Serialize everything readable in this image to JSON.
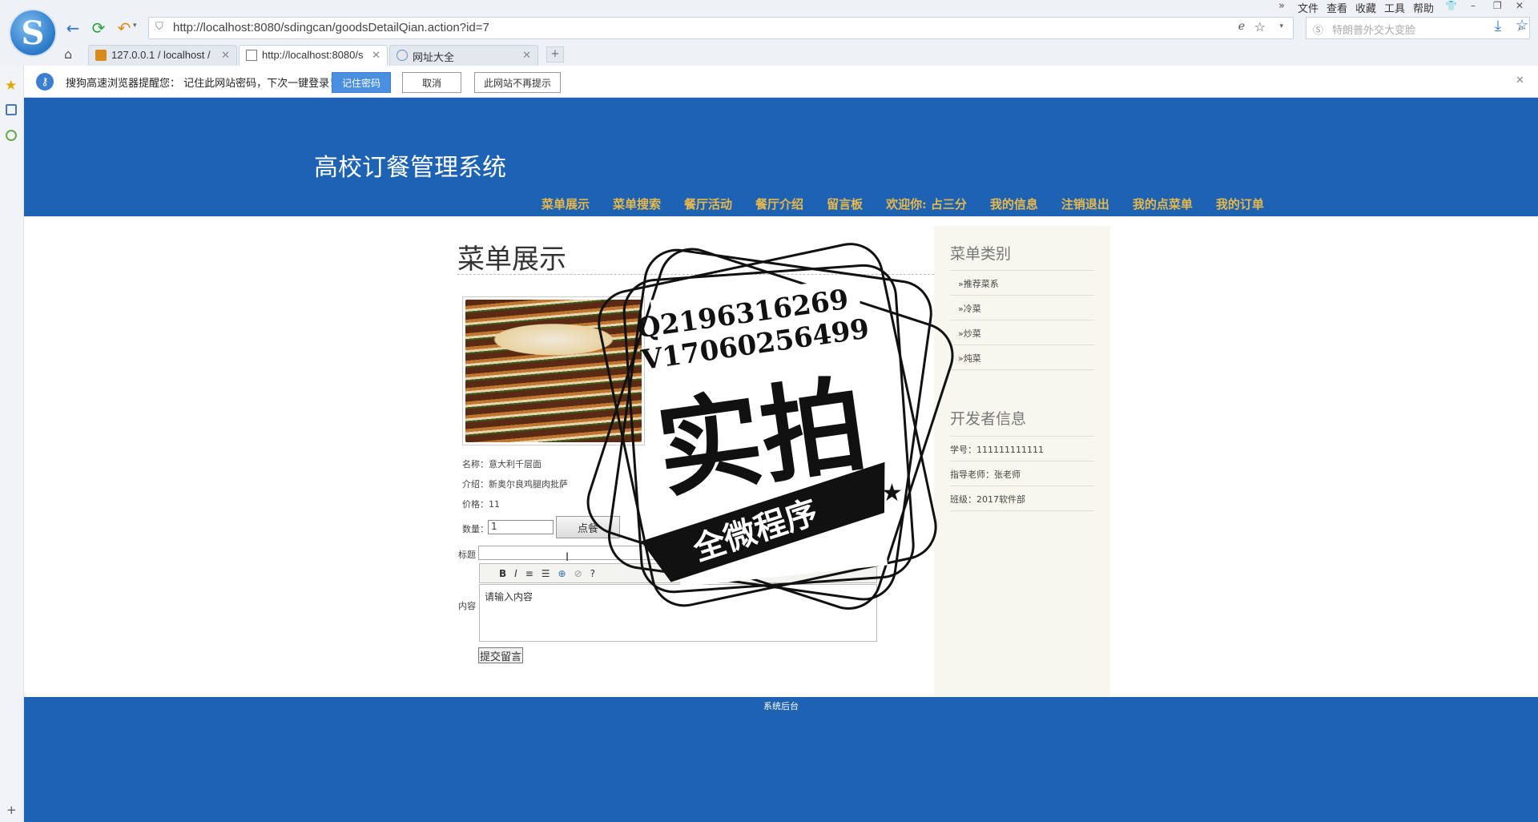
{
  "browser": {
    "url": "http://localhost:8080/sdingcan/goodsDetailQian.action?id=7",
    "search_placeholder": "特朗普外交大变脸",
    "menu": [
      "文件",
      "查看",
      "收藏",
      "工具",
      "帮助"
    ],
    "tabs": [
      {
        "label": "127.0.0.1 / localhost /",
        "active": false
      },
      {
        "label": "http://localhost:8080/s",
        "active": true
      },
      {
        "label": "网址大全",
        "active": false
      }
    ],
    "accent": "#2a78c8"
  },
  "password_bar": {
    "message": "搜狗高速浏览器提醒您： 记住此网站密码，下次一键登录！",
    "remember": "记住密码",
    "cancel": "取消",
    "never": "此网站不再提示"
  },
  "site": {
    "title": "高校订餐管理系统",
    "nav": [
      "菜单展示",
      "菜单搜索",
      "餐厅活动",
      "餐厅介绍",
      "留言板",
      "欢迎你: 占三分",
      "我的信息",
      "注销退出",
      "我的点菜单",
      "我的订单"
    ],
    "header_color": "#1d62b3",
    "nav_color": "#e8b84a"
  },
  "main": {
    "title": "菜单展示",
    "name": "名称：意大利千层面",
    "intro": "介绍：新奥尔良鸡腿肉批萨",
    "price": "价格：11",
    "qty_label": "数量：",
    "qty_value": "1",
    "order_button": "点餐",
    "title_label": "标题",
    "content_label": "内容",
    "editor_text": "请输入内容",
    "submit": "提交留言"
  },
  "right": {
    "category_title": "菜单类别",
    "categories": [
      "»推荐菜系",
      "»冷菜",
      "»炒菜",
      "»炖菜"
    ],
    "dev_title": "开发者信息",
    "dev_items": [
      "学号：111111111111",
      "指导老师：张老师",
      "班级：2017软件部"
    ]
  },
  "footer": {
    "link": "系统后台"
  },
  "watermark": {
    "line1": "Q2196316269",
    "line2": "V17060256499",
    "big": "实拍",
    "banner": "全微程序"
  }
}
